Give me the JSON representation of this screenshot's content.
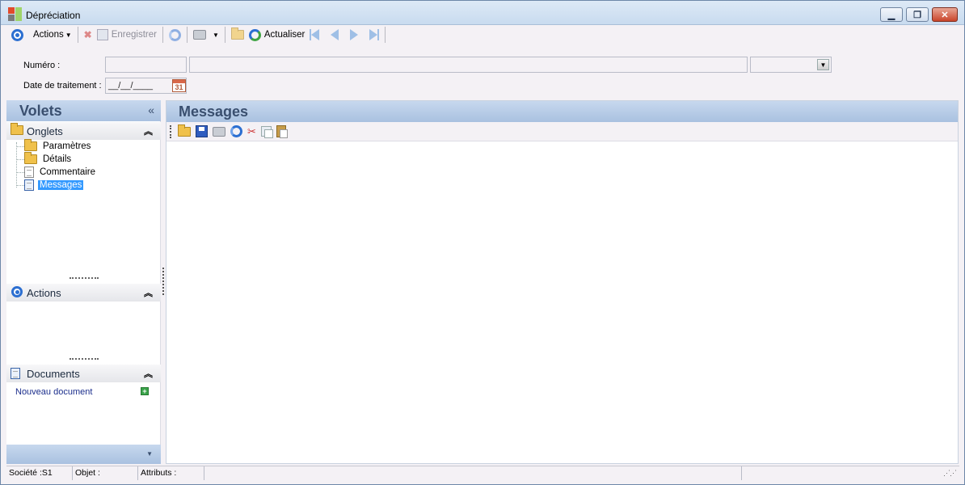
{
  "window": {
    "title": "Dépréciation"
  },
  "toolbar": {
    "actions_label": "Actions",
    "save_label": "Enregistrer",
    "refresh_label": "Actualiser"
  },
  "form": {
    "numero_label": "Numéro :",
    "date_label": "Date de traitement :",
    "date_value": "__/__/____",
    "calendar_label": "31"
  },
  "left_panel": {
    "title": "Volets",
    "collapse_glyph": "«",
    "onglets": {
      "label": "Onglets",
      "items": [
        {
          "label": "Paramètres",
          "icon": "folder-icon"
        },
        {
          "label": "Détails",
          "icon": "folder-icon"
        },
        {
          "label": "Commentaire",
          "icon": "page-icon"
        },
        {
          "label": "Messages",
          "icon": "page-icon",
          "selected": true
        }
      ]
    },
    "actions": {
      "label": "Actions"
    },
    "documents": {
      "label": "Documents",
      "new_document": "Nouveau document"
    }
  },
  "right_panel": {
    "title": "Messages"
  },
  "statusbar": {
    "societe": "Société :S1",
    "objet": "Objet :",
    "attributs": "Attributs :"
  }
}
